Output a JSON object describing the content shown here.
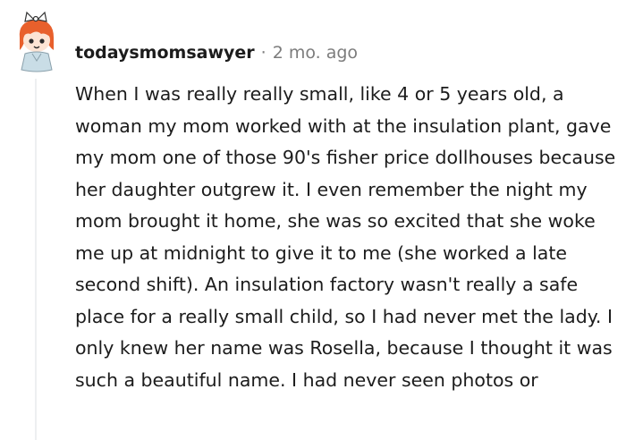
{
  "comment": {
    "author": "todaysmomsawyer",
    "separator": "·",
    "age": "2 mo. ago",
    "body": "When I was really really small, like 4 or 5 years old, a woman my mom worked with at the insulation plant, gave my mom one of those 90's fisher price dollhouses because her daughter outgrew it. I even remember the night my mom brought it home, she was so excited that she woke me up at midnight to give it to me (she worked a late second shift). An insulation factory wasn't really a safe place for a really small child, so I had never met the lady. I only knew her name was Rosella, because I thought it was such a beautiful name. I had never seen photos or"
  },
  "avatar": {
    "icon": "snoo-avatar-icon",
    "colors": {
      "hair": "#e8602c",
      "skin": "#fce4d4",
      "shirt": "#c9dde6",
      "bow": "#ffffff"
    }
  },
  "colors": {
    "text": "#1c1c1c",
    "meta": "#7c7c7c",
    "thread_line": "#edeff1"
  }
}
